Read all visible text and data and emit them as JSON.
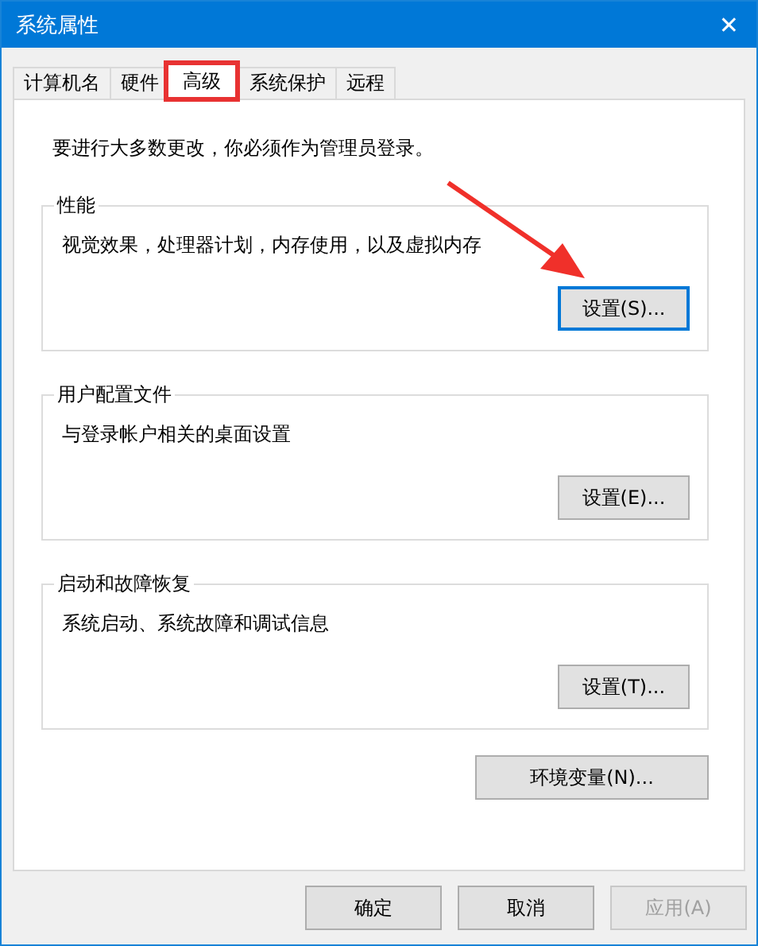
{
  "window": {
    "title": "系统属性",
    "close": "✕"
  },
  "tabs": [
    {
      "label": "计算机名",
      "selected": false,
      "highlighted": false
    },
    {
      "label": "硬件",
      "selected": false,
      "highlighted": false
    },
    {
      "label": "高级",
      "selected": true,
      "highlighted": true
    },
    {
      "label": "系统保护",
      "selected": false,
      "highlighted": false
    },
    {
      "label": "远程",
      "selected": false,
      "highlighted": false
    }
  ],
  "notice": "要进行大多数更改，你必须作为管理员登录。",
  "groups": [
    {
      "title": "性能",
      "description": "视觉效果，处理器计划，内存使用，以及虚拟内存",
      "button": {
        "label": "设置(S)...",
        "focused": true,
        "arrow": true
      }
    },
    {
      "title": "用户配置文件",
      "description": "与登录帐户相关的桌面设置",
      "button": {
        "label": "设置(E)...",
        "focused": false,
        "arrow": false
      }
    },
    {
      "title": "启动和故障恢复",
      "description": "系统启动、系统故障和调试信息",
      "button": {
        "label": "设置(T)...",
        "focused": false,
        "arrow": false
      }
    }
  ],
  "env_button": {
    "label": "环境变量(N)..."
  },
  "footer_buttons": [
    {
      "label": "确定",
      "disabled": false
    },
    {
      "label": "取消",
      "disabled": false
    },
    {
      "label": "应用(A)",
      "disabled": true
    }
  ]
}
